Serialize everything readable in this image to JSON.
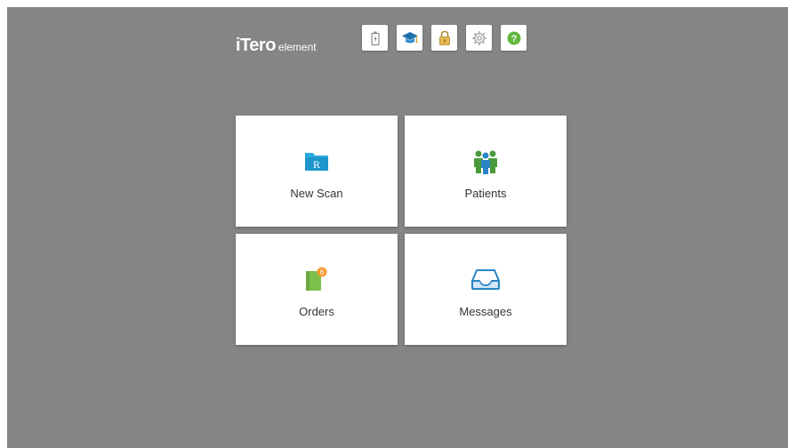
{
  "brand": {
    "name": "iTero",
    "product": "element",
    "accent_color": "#29a9e0"
  },
  "toolbar": {
    "buttons": [
      {
        "name": "battery-icon",
        "title": "Battery"
      },
      {
        "name": "graduation-cap-icon",
        "title": "Training"
      },
      {
        "name": "lock-icon",
        "title": "Lock"
      },
      {
        "name": "gear-icon",
        "title": "Settings"
      },
      {
        "name": "help-icon",
        "title": "Help",
        "glyph": "?"
      }
    ]
  },
  "tiles": {
    "new_scan": {
      "label": "New Scan",
      "icon": "folder-rx-icon",
      "icon_glyph": "R"
    },
    "patients": {
      "label": "Patients",
      "icon": "patients-group-icon"
    },
    "orders": {
      "label": "Orders",
      "icon": "orders-clipboard-icon",
      "badge": "6"
    },
    "messages": {
      "label": "Messages",
      "icon": "inbox-tray-icon"
    }
  },
  "colors": {
    "background": "#858585",
    "tile_background": "#ffffff",
    "folder_blue": "#29a9e0",
    "orders_green": "#7cc04b",
    "badge_orange": "#f39a2e",
    "help_green": "#62b83f",
    "lock_gold": "#e5b64f"
  }
}
